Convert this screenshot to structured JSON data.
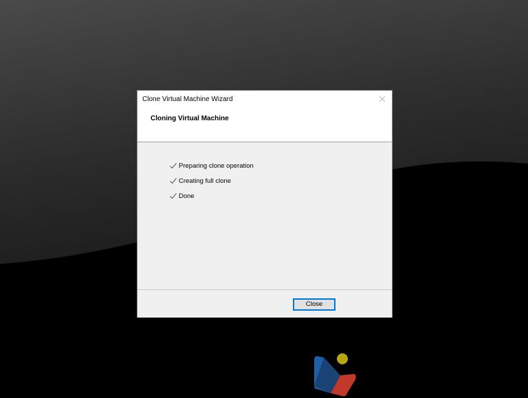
{
  "window": {
    "title": "Clone Virtual Machine Wizard",
    "close_icon": "close-icon"
  },
  "header": {
    "title": "Cloning Virtual Machine"
  },
  "steps": [
    {
      "label": "Preparing clone operation",
      "icon": "check-icon",
      "status": "done"
    },
    {
      "label": "Creating full clone",
      "icon": "check-icon",
      "status": "done"
    },
    {
      "label": "Done",
      "icon": "check-icon",
      "status": "done"
    }
  ],
  "footer": {
    "close_label": "Close"
  },
  "colors": {
    "accent": "#0078d7",
    "dialog_body": "#f0f0f0",
    "logo_blue": "#1f5fa8",
    "logo_red": "#c0392b",
    "logo_yellow": "#b5a614"
  }
}
